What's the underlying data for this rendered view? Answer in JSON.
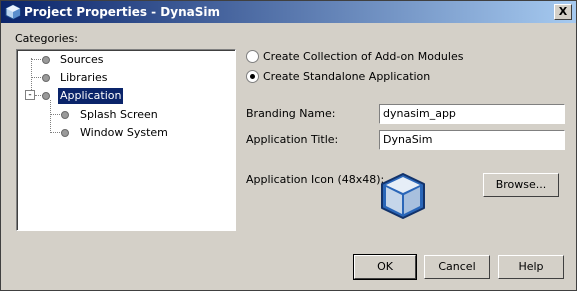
{
  "window": {
    "title": "Project Properties - DynaSim",
    "close_label": "X"
  },
  "categories": {
    "label": "Categories:",
    "items": [
      {
        "label": "Sources",
        "level": 0,
        "selected": false
      },
      {
        "label": "Libraries",
        "level": 0,
        "selected": false
      },
      {
        "label": "Application",
        "level": 0,
        "selected": true,
        "expanded": true
      },
      {
        "label": "Splash Screen",
        "level": 1,
        "selected": false
      },
      {
        "label": "Window System",
        "level": 1,
        "selected": false
      }
    ],
    "expander_symbol": "-"
  },
  "options": {
    "radio_collection": {
      "label": "Create Collection of Add-on Modules",
      "checked": false
    },
    "radio_standalone": {
      "label": "Create Standalone Application",
      "checked": true
    }
  },
  "form": {
    "branding_label": "Branding Name:",
    "branding_value": "dynasim_app",
    "title_label": "Application Title:",
    "title_value": "DynaSim",
    "icon_label": "Application Icon (48x48):",
    "browse_label": "Browse..."
  },
  "footer": {
    "ok_label": "OK",
    "cancel_label": "Cancel",
    "help_label": "Help"
  },
  "colors": {
    "title_start": "#0a246a",
    "title_end": "#a6caf0",
    "selection": "#0a246a",
    "app_icon": "#1f5fb0"
  }
}
